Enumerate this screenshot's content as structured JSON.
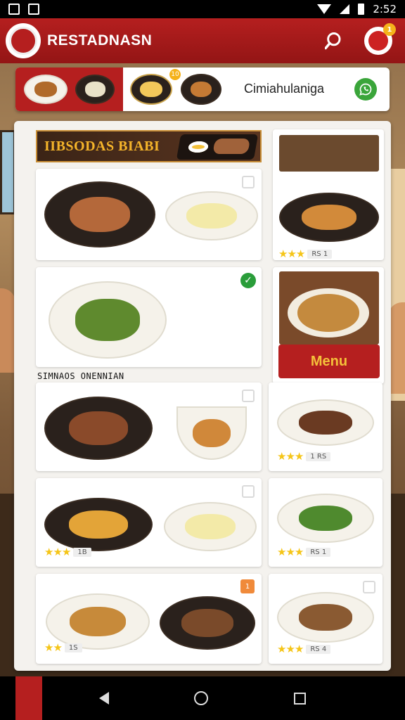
{
  "statusbar": {
    "time": "2:52"
  },
  "app": {
    "title": "RESTADNASN",
    "notification_count": "1"
  },
  "promo": {
    "badge": "10",
    "text": "Cimiahulaniga"
  },
  "banner": {
    "title": "IIBSODAS BIABI"
  },
  "section": {
    "label": "SIMNAOS ONENNIAN"
  },
  "side_panel": {
    "price_1": "RS 1",
    "menu_label": "Menu"
  },
  "cards": {
    "r1_price": "1 RS",
    "r2_left_price": "1B",
    "r2_right_price": "RS 1",
    "r3_left_price": "1S",
    "r3_right_price": "RS 4",
    "r3_badge": "1"
  },
  "colors": {
    "brand_red": "#b51f1f",
    "accent_yellow": "#f4c13a",
    "check_green": "#2a9d3a",
    "star_gold": "#f5c518"
  }
}
